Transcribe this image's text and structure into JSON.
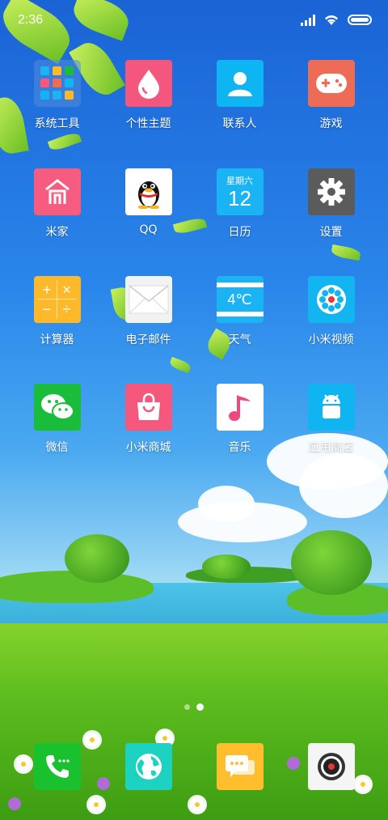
{
  "status_bar": {
    "time": "2:36",
    "signal_icon": "signal-bars-icon",
    "wifi_icon": "wifi-icon",
    "battery_icon": "battery-icon"
  },
  "apps": [
    {
      "label": "系统工具",
      "icon": "folder-icon",
      "color": "#3a8fd8"
    },
    {
      "label": "个性主题",
      "icon": "theme-drop-icon",
      "color": "#f3577e"
    },
    {
      "label": "联系人",
      "icon": "contacts-icon",
      "color": "#0fb5f2"
    },
    {
      "label": "游戏",
      "icon": "gamepad-icon",
      "color": "#ee6b55"
    },
    {
      "label": "米家",
      "icon": "home-icon",
      "color": "#f55c7f"
    },
    {
      "label": "QQ",
      "icon": "qq-penguin-icon",
      "color": "#ffffff"
    },
    {
      "label": "日历",
      "icon": "calendar-icon",
      "color": "#1ab3f4"
    },
    {
      "label": "设置",
      "icon": "gear-icon",
      "color": "#5b5b5b"
    },
    {
      "label": "计算器",
      "icon": "calculator-icon",
      "color": "#fdb929"
    },
    {
      "label": "电子邮件",
      "icon": "mail-icon",
      "color": "#f2f2f2"
    },
    {
      "label": "天气",
      "icon": "weather-icon",
      "color": "#1ab3f4"
    },
    {
      "label": "小米视频",
      "icon": "video-reel-icon",
      "color": "#13b5f1"
    },
    {
      "label": "微信",
      "icon": "wechat-icon",
      "color": "#19bd3b"
    },
    {
      "label": "小米商城",
      "icon": "shopping-bag-icon",
      "color": "#f5577d"
    },
    {
      "label": "音乐",
      "icon": "music-note-icon",
      "color": "#ffffff"
    },
    {
      "label": "应用商店",
      "icon": "android-icon",
      "color": "#10b4f0"
    }
  ],
  "calendar": {
    "weekday": "星期六",
    "day": "12"
  },
  "weather": {
    "temp": "4℃"
  },
  "calculator": {
    "plus": "+",
    "times": "×",
    "minus": "−",
    "divide": "÷"
  },
  "qq_text": "QQ",
  "dock": [
    {
      "icon": "phone-icon",
      "color": "#1ac12f"
    },
    {
      "icon": "browser-globe-icon",
      "color": "#1ed2c1"
    },
    {
      "icon": "messages-icon",
      "color": "#ffbe2e"
    },
    {
      "icon": "camera-icon",
      "color": "#f5f5f5"
    }
  ],
  "pages": {
    "count": 2,
    "active": 2
  }
}
